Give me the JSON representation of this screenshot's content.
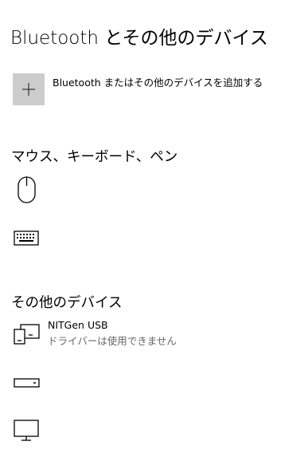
{
  "page": {
    "title": "Bluetooth とその他のデバイス"
  },
  "add_device": {
    "label": "Bluetooth またはその他のデバイスを追加する",
    "icon": "plus-icon"
  },
  "sections": [
    {
      "title": "マウス、キーボード、ペン",
      "devices": [
        {
          "name": "",
          "icon": "mouse-icon"
        },
        {
          "name": "",
          "icon": "keyboard-icon"
        }
      ]
    },
    {
      "title": "その他のデバイス",
      "devices": [
        {
          "name": "NITGen USB",
          "status": "ドライバーは使用できません",
          "icon": "usb-device-icon"
        },
        {
          "name": "",
          "icon": "drive-icon"
        },
        {
          "name": "",
          "icon": "monitor-icon"
        }
      ]
    }
  ],
  "colors": {
    "tile_bg": "#cccccc",
    "secondary_text": "#666666",
    "icon_stroke": "#000000"
  }
}
